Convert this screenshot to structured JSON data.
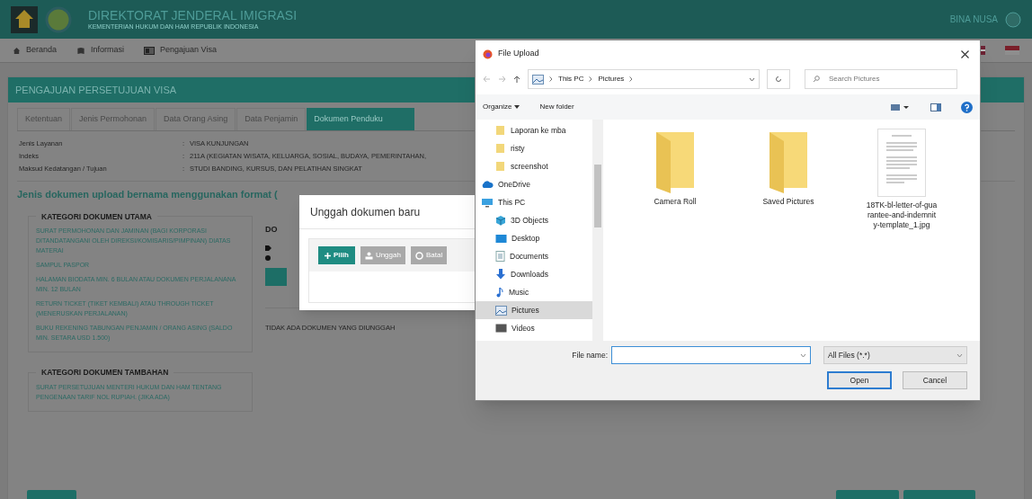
{
  "header": {
    "title": "DIREKTORAT JENDERAL IMIGRASI",
    "subtitle": "KEMENTERIAN HUKUM DAN HAM REPUBLIK INDONESIA",
    "user": "BINA NUSA"
  },
  "nav": [
    {
      "label": "Beranda"
    },
    {
      "label": "Informasi"
    },
    {
      "label": "Pengajuan Visa"
    }
  ],
  "panel_title": "PENGAJUAN PERSETUJUAN VISA",
  "tabs": [
    {
      "label": "Ketentuan",
      "selected": false
    },
    {
      "label": "Jenis Permohonan",
      "selected": false
    },
    {
      "label": "Data Orang Asing",
      "selected": false
    },
    {
      "label": "Data Penjamin",
      "selected": false
    },
    {
      "label": "Dokumen Penduku",
      "selected": true
    }
  ],
  "details": [
    {
      "label": "Jenis Layanan",
      "separator": ":",
      "value": "VISA KUNJUNGAN"
    },
    {
      "label": "Indeks",
      "separator": ":",
      "value": "211A  (KEGIATAN WISATA, KELUARGA, SOSIAL, BUDAYA, PEMERINTAHAN,"
    },
    {
      "label": "Maksud Kedatangan / Tujuan",
      "separator": ":",
      "value": "STUDI BANDING, KURSUS, DAN PELATIHAN SINGKAT"
    }
  ],
  "format_note": "Jenis dokumen upload bernama menggunakan format (",
  "main_category": {
    "title": "KATEGORI DOKUMEN UTAMA",
    "items": [
      "SURAT PERMOHONAN DAN JAMINAN (BAGI KORPORASI DITANDATANGANI OLEH DIREKSI/KOMISARIS/PIMPINAN) DIATAS MATERAI",
      "SAMPUL PASPOR",
      "HALAMAN BIODATA MIN. 6 BULAN ATAU DOKUMEN PERJALANANA MIN. 12 BULAN",
      "RETURN TICKET (TIKET KEMBALI) ATAU THROUGH TICKET (MENERUSKAN PERJALANAN)",
      "BUKU REKENING TABUNGAN PENJAMIN / ORANG ASING (SALDO MIN. SETARA USD 1.500)"
    ]
  },
  "extra_category": {
    "title": "KATEGORI DOKUMEN TAMBAHAN",
    "items": [
      "SURAT PERSETUJUAN MENTERI HUKUM DAN HAM TENTANG PENGENAAN TARIF NOL RUPIAH. (JIKA ADA)"
    ]
  },
  "documents": {
    "heading": "DO",
    "empty_text": "TIDAK ADA DOKUMEN YANG DIUNGGAH"
  },
  "upload_modal": {
    "title": "Unggah dokumen baru",
    "buttons": [
      {
        "label": "Pilih",
        "disabled": false
      },
      {
        "label": "Unggah",
        "disabled": true
      },
      {
        "label": "Batal",
        "disabled": true
      }
    ]
  },
  "file_dialog": {
    "title": "File Upload",
    "path": [
      "This PC",
      "Pictures"
    ],
    "search_placeholder": "Search Pictures",
    "organize": "Organize",
    "new_folder": "New folder",
    "sidebar": [
      {
        "label": "Laporan ke mba",
        "selected": false
      },
      {
        "label": "risty",
        "selected": false
      },
      {
        "label": "screenshot",
        "selected": false
      },
      {
        "label": "OneDrive",
        "selected": false
      },
      {
        "label": "This PC",
        "selected": false
      },
      {
        "label": "3D Objects",
        "selected": false
      },
      {
        "label": "Desktop",
        "selected": false
      },
      {
        "label": "Documents",
        "selected": false
      },
      {
        "label": "Downloads",
        "selected": false
      },
      {
        "label": "Music",
        "selected": false
      },
      {
        "label": "Pictures",
        "selected": true
      },
      {
        "label": "Videos",
        "selected": false
      }
    ],
    "files": [
      {
        "name": "Camera Roll",
        "kind": "folder"
      },
      {
        "name": "Saved Pictures",
        "kind": "folder"
      },
      {
        "name": "18TK-bl-letter-of-guarantee-and-indemnity-template_1.jpg",
        "kind": "image"
      }
    ],
    "file_name_label": "File name:",
    "file_type": "All Files (*.*)",
    "open": "Open",
    "cancel": "Cancel"
  }
}
